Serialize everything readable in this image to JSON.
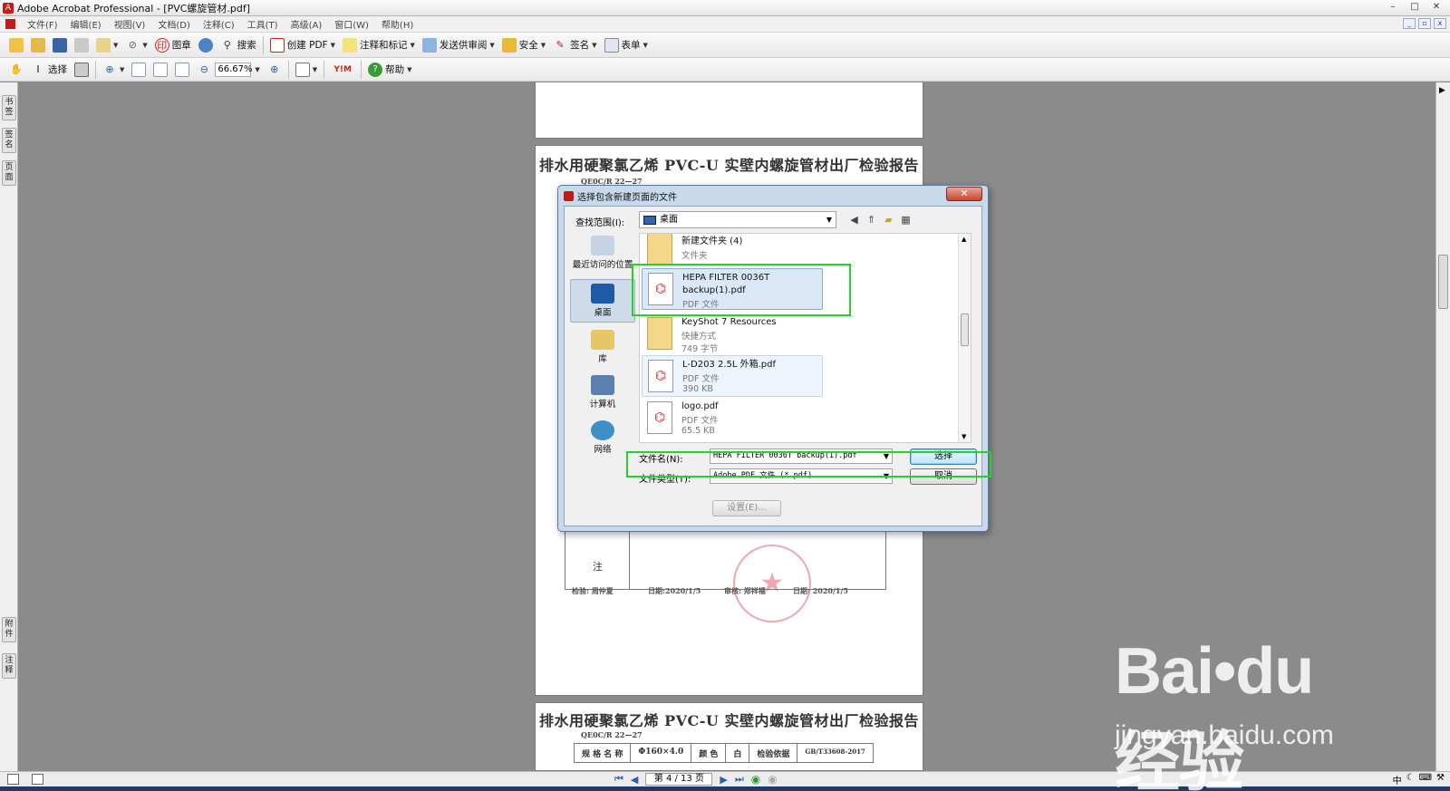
{
  "window": {
    "title": "Adobe Acrobat Professional - [PVC螺旋管材.pdf]",
    "buttons": [
      "–",
      "□",
      "✕"
    ]
  },
  "menu": [
    "文件(F)",
    "编辑(E)",
    "视图(V)",
    "文档(D)",
    "注释(C)",
    "工具(T)",
    "高级(A)",
    "窗口(W)",
    "帮助(H)"
  ],
  "toolbar1": {
    "stamp": "图章",
    "search": "搜索",
    "create_pdf": "创建 PDF",
    "comment": "注释和标记",
    "send_review": "发送供审阅",
    "security": "安全",
    "sign": "签名",
    "forms": "表单"
  },
  "toolbar2": {
    "select": "选择",
    "zoom": "66.67%",
    "help": "帮助"
  },
  "left_tabs": [
    "书签",
    "签名",
    "页面",
    "附件",
    "注释"
  ],
  "document": {
    "report_title": "排水用硬聚氯乙烯 PVC-U 实壁内螺旋管材出厂检验报告",
    "report_code": "QE0C/R 22—27",
    "note_label": "注",
    "inspector": "检验: 周仲夏",
    "date1": "日期:2020/1/5",
    "reviewer": "审核: 郑祥福",
    "date2": "日期: 2020/1/5",
    "spec_row": [
      "规 格 名 称",
      "Φ160×4.0",
      "颜 色",
      "白",
      "检验依据",
      "GB/T33608-2017"
    ]
  },
  "dialog": {
    "title": "选择包含新建页面的文件",
    "close": "✕",
    "lookin_label": "查找范围(I):",
    "lookin_value": "桌面",
    "places": [
      {
        "label": "最近访问的位置"
      },
      {
        "label": "桌面"
      },
      {
        "label": "库"
      },
      {
        "label": "计算机"
      },
      {
        "label": "网络"
      }
    ],
    "files": [
      {
        "name": "新建文件夹 (4)",
        "type": "文件夹",
        "size": ""
      },
      {
        "name": "HEPA FILTER 0036T backup(1).pdf",
        "name_line1": "HEPA FILTER 0036T",
        "name_line2": "backup(1).pdf",
        "type": "PDF 文件",
        "size": ""
      },
      {
        "name": "KeyShot 7 Resources",
        "type": "快捷方式",
        "size": "749 字节"
      },
      {
        "name": "L-D203 2.5L 外箱.pdf",
        "type": "PDF 文件",
        "size": "390 KB"
      },
      {
        "name": "logo.pdf",
        "type": "PDF 文件",
        "size": "65.5 KB"
      }
    ],
    "filename_label": "文件名(N):",
    "filename_value": "HEPA FILTER 0036T backup(1).pdf",
    "filetype_label": "文件类型(T):",
    "filetype_value": "Adobe PDF 文件 (*.pdf)",
    "select_button": "选择",
    "cancel_button": "取消",
    "settings_button": "设置(E)..."
  },
  "statusbar": {
    "page_indicator": "第 4 / 13 页",
    "tray": "中"
  },
  "watermark": {
    "logo": "Bai•du 经验",
    "url": "jingyan.baidu.com"
  },
  "colors": {
    "highlight": "#25d12a",
    "acrobat_red": "#c41818"
  }
}
